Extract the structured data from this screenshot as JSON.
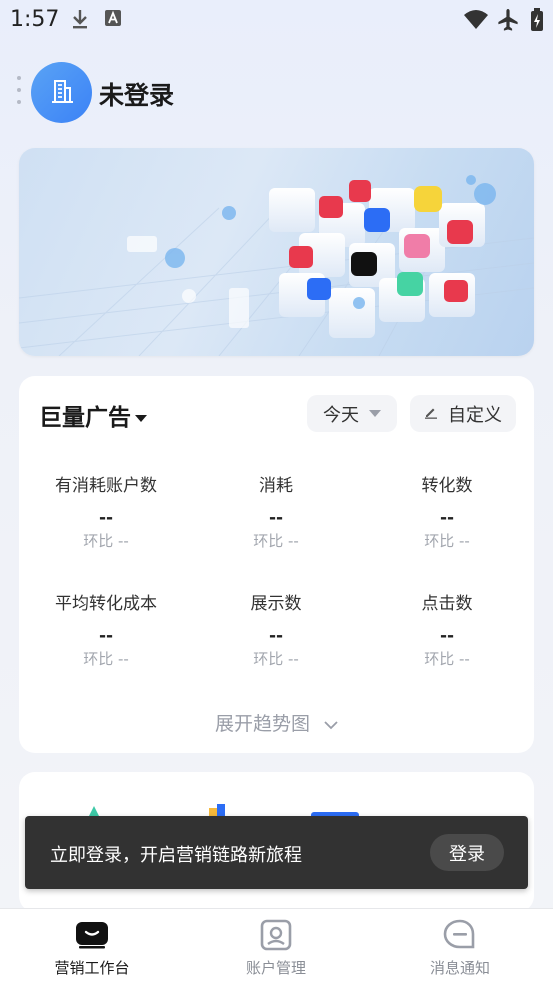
{
  "status_bar": {
    "time": "1:57"
  },
  "header": {
    "title": "未登录"
  },
  "card": {
    "title": "巨量广告",
    "filters": {
      "today": "今天",
      "custom": "自定义"
    },
    "metrics": [
      {
        "label": "有消耗账户数",
        "value": "--",
        "ratio": "环比 --"
      },
      {
        "label": "消耗",
        "value": "--",
        "ratio": "环比 --"
      },
      {
        "label": "转化数",
        "value": "--",
        "ratio": "环比 --"
      },
      {
        "label": "平均转化成本",
        "value": "--",
        "ratio": "环比 --"
      },
      {
        "label": "展示数",
        "value": "--",
        "ratio": "环比 --"
      },
      {
        "label": "点击数",
        "value": "--",
        "ratio": "环比 --"
      }
    ],
    "expand": "展开趋势图"
  },
  "toast": {
    "text": "立即登录，开启营销链路新旅程",
    "button": "登录"
  },
  "tabs": [
    {
      "label": "营销工作台",
      "icon": "workbench-icon",
      "active": true
    },
    {
      "label": "账户管理",
      "icon": "account-icon",
      "active": false
    },
    {
      "label": "消息通知",
      "icon": "message-icon",
      "active": false
    }
  ]
}
